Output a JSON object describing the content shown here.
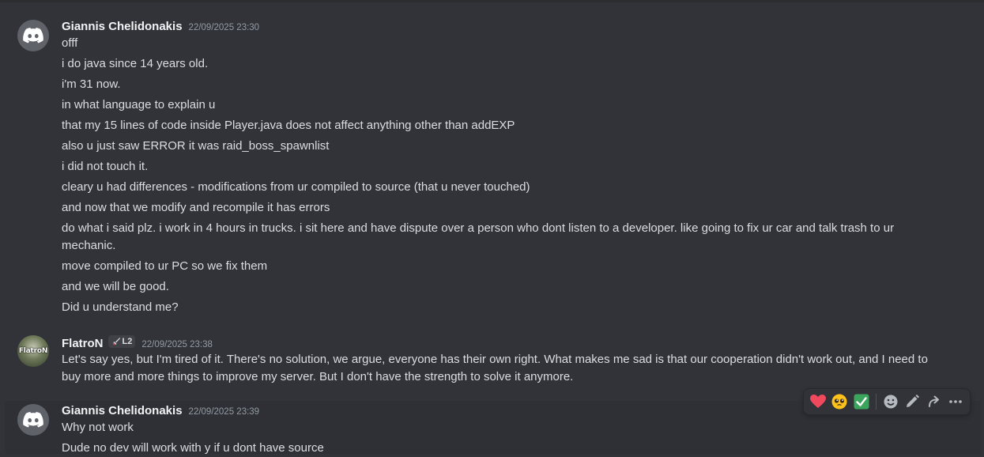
{
  "messages": [
    {
      "username": "Giannis Chelidonakis",
      "timestamp": "22/09/2025 23:30",
      "avatar": "discord-default",
      "lines": [
        "offf",
        "i do java since 14 years old.",
        "i'm 31 now.",
        "in what language to explain u",
        "that my 15 lines of code inside Player.java does not affect anything other than addEXP",
        "also u just saw ERROR it was raid_boss_spawnlist",
        "i did not touch it.",
        "cleary u had differences - modifications from ur compiled to source (that u never touched)",
        "and now that we modify and recompile it has errors",
        "do what i said plz. i work in 4 hours in trucks. i sit here and have dispute over a person who dont listen to a developer. like going to fix ur car and talk trash to ur mechanic.",
        "move compiled to ur PC so we fix them",
        "and we will be good.",
        "Did u understand me?"
      ]
    },
    {
      "username": "FlatroN",
      "tag": "L2",
      "timestamp": "22/09/2025 23:38",
      "avatar_text": "FlatroN",
      "lines": [
        "Let's say yes, but I'm tired of it. There's no solution, we argue, everyone has their own right. What makes me sad is that our cooperation didn't work out, and I need to buy more and more things to improve my server. But I don't have the strength to solve it anymore."
      ]
    },
    {
      "username": "Giannis Chelidonakis",
      "timestamp": "22/09/2025 23:39",
      "avatar": "discord-default",
      "lines": [
        "Why not work",
        "Dude no dev will work with y if u dont have source"
      ]
    }
  ],
  "toolbar": {
    "reactions": [
      "heart-emoji",
      "pleading-face-emoji",
      "check-mark-emoji"
    ],
    "actions": [
      "add-reaction-icon",
      "edit-icon",
      "forward-icon",
      "more-icon"
    ]
  },
  "colors": {
    "background": "#313338",
    "hover": "#2e3035",
    "username": "#f2f3f5",
    "timestamp": "#949ba4",
    "text": "#dbdee1",
    "check": "#3ba55d",
    "heart": "#f0485c"
  }
}
